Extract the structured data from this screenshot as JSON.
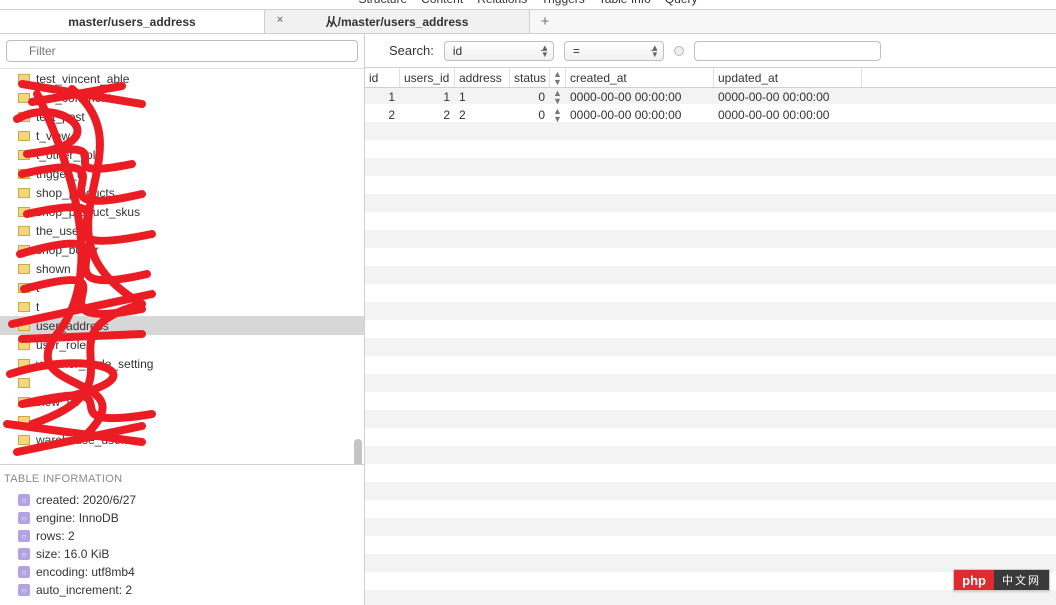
{
  "toolbar_menu": [
    "Structure",
    "Content",
    "Relations",
    "Triggers",
    "Table Info",
    "Query"
  ],
  "tabs": [
    {
      "label": "master/users_address",
      "active": true
    },
    {
      "label": "从/master/users_address",
      "active": false
    }
  ],
  "sidebar": {
    "filter_placeholder": "Filter",
    "items": [
      "test_vincent_able",
      "test_comment",
      "test_post",
      "t_view",
      "t_other_cols",
      "trigger_t",
      "shop_products",
      "shop_product_skus",
      "the_users",
      "shop_buyer",
      "shown",
      "t",
      "t",
      "user_address",
      "user_role",
      "voucher_code_setting",
      "",
      "view_us",
      "",
      "warehouse_users"
    ],
    "selected_index": 13
  },
  "table_info": {
    "heading": "TABLE INFORMATION",
    "rows": [
      {
        "k": "created",
        "v": "2020/6/27"
      },
      {
        "k": "engine",
        "v": "InnoDB"
      },
      {
        "k": "rows",
        "v": "2"
      },
      {
        "k": "size",
        "v": "16.0 KiB"
      },
      {
        "k": "encoding",
        "v": "utf8mb4"
      },
      {
        "k": "auto_increment",
        "v": "2"
      }
    ]
  },
  "search": {
    "label": "Search:",
    "field": "id",
    "op": "=",
    "query": ""
  },
  "grid": {
    "columns": [
      "id",
      "users_id",
      "address",
      "status",
      "created_at",
      "updated_at"
    ],
    "rows": [
      {
        "id": "1",
        "users_id": "1",
        "address": "1",
        "status": "0",
        "created_at": "0000-00-00 00:00:00",
        "updated_at": "0000-00-00 00:00:00"
      },
      {
        "id": "2",
        "users_id": "2",
        "address": "2",
        "status": "0",
        "created_at": "0000-00-00 00:00:00",
        "updated_at": "0000-00-00 00:00:00"
      }
    ]
  },
  "footer": {
    "php": "php",
    "cn": "中文网"
  }
}
